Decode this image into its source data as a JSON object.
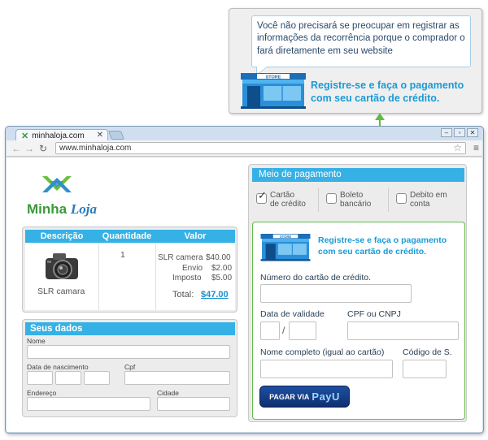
{
  "callout": {
    "bubble_text": "Você não precisará se preocupar em registrar as informações da recorrência porque o comprador o fará diretamente em seu website",
    "store_sign": "STORE",
    "action_text": "Registre-se e faça o pagamento com seu cartão de crédito."
  },
  "browser": {
    "tab_title": "minhaloja.com",
    "url": "www.minhaloja.com",
    "back_icon": "back-arrow-icon",
    "forward_icon": "forward-arrow-icon",
    "reload_icon": "reload-icon"
  },
  "logo": {
    "part1": "Minha",
    "part2": "Loja"
  },
  "order": {
    "headers": [
      "Descrição",
      "Quantidade",
      "Valor"
    ],
    "product_name": "SLR camara",
    "quantity": "1",
    "lines": [
      {
        "label": "SLR camera",
        "value": "$40.00"
      },
      {
        "label": "Envio",
        "value": "$2.00"
      },
      {
        "label": "Imposto",
        "value": "$5.00"
      }
    ],
    "total_label": "Total:",
    "total_value": "$47.00"
  },
  "customer": {
    "title": "Seus dados",
    "name_label": "Nome",
    "birth_label": "Data de nascimento",
    "cpf_label": "Cpf",
    "address_label": "Endereço",
    "city_label": "Cidade"
  },
  "payment": {
    "title": "Meio de pagamento",
    "options": [
      {
        "line1": "Cartão",
        "line2": "de crédito",
        "checked": true
      },
      {
        "line1": "Boleto",
        "line2": "bancário",
        "checked": false
      },
      {
        "line1": "Debito em",
        "line2": "conta",
        "checked": false
      }
    ],
    "store_sign": "STORE",
    "card_text": "Registre-se e faça o pagamento com seu cartão de crédito.",
    "card_number_label": "Número do cartão de crédito.",
    "expiry_label": "Data de validade",
    "expiry_sep": "/",
    "cpf_cnpj_label": "CPF ou CNPJ",
    "full_name_label": "Nome completo (igual ao cartão)",
    "code_label": "Código de S.",
    "button_prefix": "PAGAR VIA",
    "button_brand": "PayU"
  },
  "colors": {
    "accent_blue": "#36b1e6",
    "link_blue": "#1a9bd7",
    "green": "#63bb47",
    "button_navy": "#1d4fa0"
  }
}
